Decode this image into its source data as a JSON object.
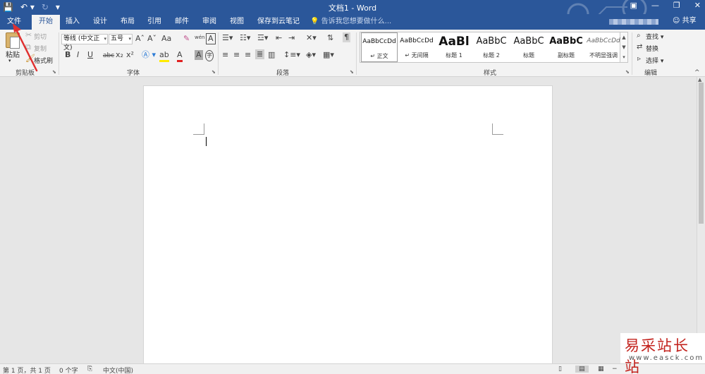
{
  "colors": {
    "accent": "#2b579a",
    "annotation": "#e03030",
    "watermark": "#c3231e"
  },
  "title_bar": {
    "doc_title": "文档1 - Word"
  },
  "qat": {
    "save_icon": "save-icon",
    "undo_icon": "undo-icon",
    "redo_icon": "redo-icon",
    "customize_icon": "qat-menu-icon"
  },
  "window_controls": {
    "ribbon_display": "ribbon-options-icon",
    "minimize": "minimize-icon",
    "restore": "restore-icon",
    "close": "close-icon"
  },
  "tabs": [
    "文件",
    "开始",
    "插入",
    "设计",
    "布局",
    "引用",
    "邮件",
    "审阅",
    "视图",
    "保存到云笔记"
  ],
  "active_tab": "开始",
  "tell_me": "告诉我您想要做什么...",
  "share": "共享",
  "clipboard": {
    "paste": "粘贴",
    "cut": "剪切",
    "copy": "复制",
    "format_painter": "格式刷",
    "label": "剪贴板"
  },
  "font": {
    "family": "等线 (中文正文)",
    "size": "五号",
    "label": "字体",
    "bold": "B",
    "italic": "I",
    "underline": "U",
    "strike": "abc",
    "sub": "x₂",
    "sup": "x²",
    "grow": "Aˆ",
    "shrink": "Aˇ",
    "case": "Aa",
    "phonetic": "wén",
    "border": "A",
    "color_a": "A",
    "highlight": "ab",
    "shade": "A",
    "enclose": "字"
  },
  "paragraph": {
    "label": "段落"
  },
  "styles": {
    "label": "样式",
    "items": [
      {
        "preview": "AaBbCcDd",
        "name": "↵ 正文"
      },
      {
        "preview": "AaBbCcDd",
        "name": "↵ 无间隔"
      },
      {
        "preview": "AaBl",
        "name": "标题 1"
      },
      {
        "preview": "AaBbC",
        "name": "标题 2"
      },
      {
        "preview": "AaBbC",
        "name": "标题"
      },
      {
        "preview": "AaBbC",
        "name": "副标题"
      },
      {
        "preview": "AaBbCcDd",
        "name": "不明显强调"
      }
    ]
  },
  "editing": {
    "find": "查找",
    "replace": "替换",
    "select": "选择",
    "label": "编辑"
  },
  "status": {
    "page": "第 1 页，共 1 页",
    "words": "0 个字",
    "language": "中文(中国)"
  },
  "watermark": {
    "text": "易采站长站",
    "url": "www.easck.com"
  }
}
